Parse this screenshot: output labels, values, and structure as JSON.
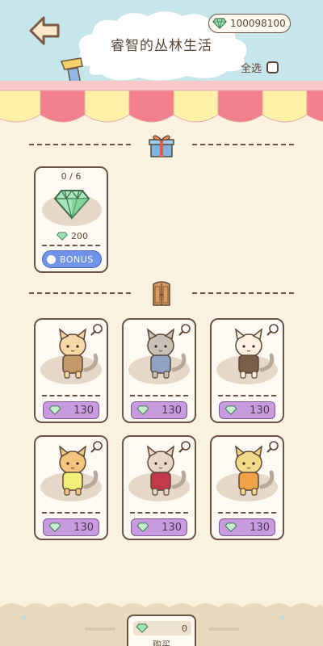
{
  "header": {
    "title": "睿智的丛林生活",
    "gem_balance": "100098100",
    "select_all_label": "全选"
  },
  "bonus_item": {
    "progress": "0 / 6",
    "gem_amount": "200",
    "button_label": "BONUS"
  },
  "characters": [
    {
      "name": "explorer-cat",
      "price": "130"
    },
    {
      "name": "scarf-cat",
      "price": "130"
    },
    {
      "name": "patch-cat",
      "price": "130"
    },
    {
      "name": "backpack-cat",
      "price": "130"
    },
    {
      "name": "bird-costume-cat",
      "price": "130"
    },
    {
      "name": "lion-costume-cat",
      "price": "130"
    }
  ],
  "footer": {
    "cart_count": "0",
    "buy_label": "购买"
  },
  "colors": {
    "sky": "#c7e6ec",
    "background": "#fbf2df",
    "price_tag": "#c89be0",
    "bonus_button": "#6f93e8",
    "outline": "#6b5444"
  }
}
